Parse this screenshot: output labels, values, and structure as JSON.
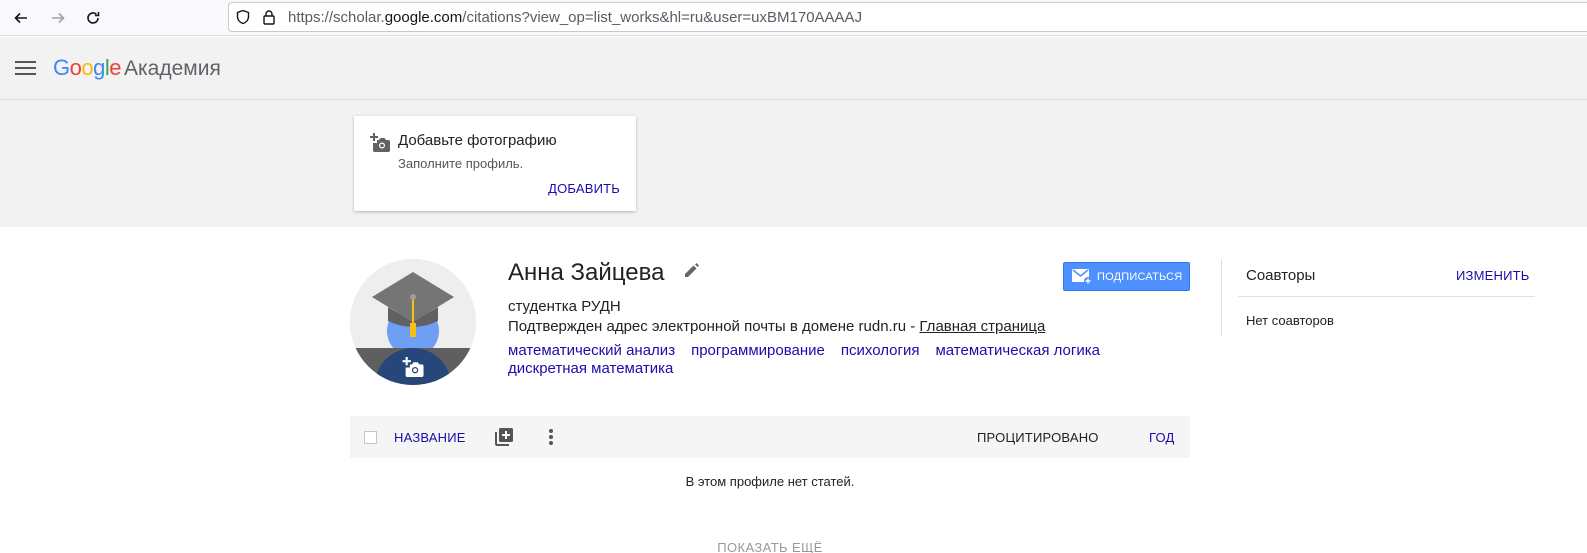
{
  "browser": {
    "url_prefix": "https://scholar.",
    "url_domain": "google.com",
    "url_suffix": "/citations?view_op=list_works&hl=ru&user=uxBM170AAAAJ"
  },
  "header": {
    "logo_letters": [
      "G",
      "o",
      "o",
      "g",
      "l",
      "e"
    ],
    "logo_colors": [
      "#4285f4",
      "#ea4335",
      "#fbbc05",
      "#4285f4",
      "#34a853",
      "#ea4335"
    ],
    "product": "Академия"
  },
  "photo_card": {
    "title": "Добавьте фотографию",
    "subtitle": "Заполните профиль.",
    "add_label": "ДОБАВИТЬ"
  },
  "profile": {
    "name": "Анна Зайцева",
    "affiliation": "студентка РУДН",
    "email_text": "Подтвержден адрес электронной почты в домене rudn.ru - ",
    "homepage_label": "Главная страница",
    "interests": [
      "математический анализ",
      "программирование",
      "психология",
      "математическая логика",
      "дискретная математика"
    ],
    "follow_label": "ПОДПИСАТЬСЯ"
  },
  "coauthors": {
    "title": "Соавторы",
    "edit_label": "ИЗМЕНИТЬ",
    "empty_text": "Нет соавторов"
  },
  "articles": {
    "col_title": "НАЗВАНИЕ",
    "col_cited": "ПРОЦИТИРОВАНО",
    "col_year": "ГОД",
    "empty_text": "В этом профиле нет статей.",
    "more_label": "ПОКАЗАТЬ ЕЩЁ"
  },
  "colors": {
    "link": "#1a0dab",
    "follow_button": "#4d90fe"
  }
}
